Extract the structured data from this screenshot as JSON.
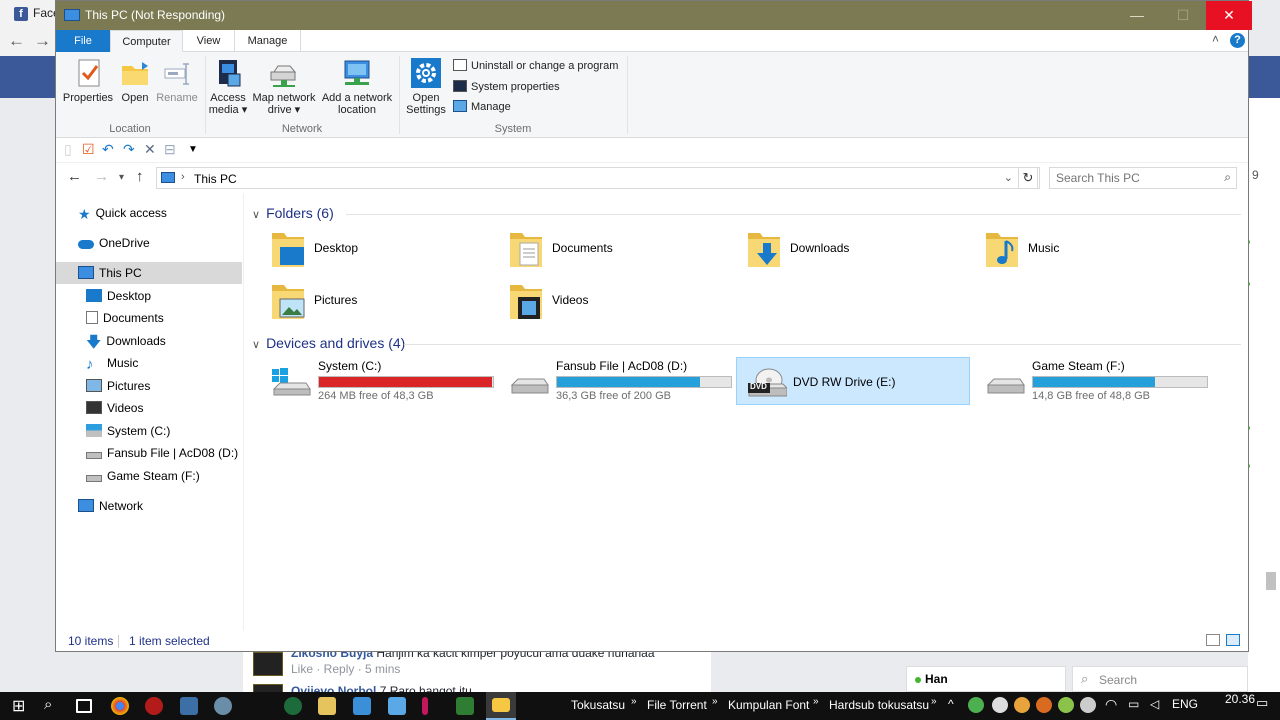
{
  "background": {
    "browser_tab": "Face",
    "comments": [
      {
        "author": "Zikosno Buyja",
        "text": "Hahjim ka kacit kimper poyucui ama duake nuhanaa"
      },
      {
        "actions": "Like · Reply · 5 mins"
      },
      {
        "author": "Ovijevo Norbol",
        "text": "7 Raro hangot itu"
      }
    ],
    "chat": {
      "name": "Han"
    },
    "search": {
      "placeholder": "Search"
    },
    "edge_digit": "9"
  },
  "window": {
    "title": "This PC (Not Responding)",
    "controls": {
      "minimize": "—",
      "maximize": "☐",
      "close": "✕"
    }
  },
  "ribbon": {
    "tabs": [
      "File",
      "Computer",
      "View",
      "Manage"
    ],
    "location": {
      "group": "Location",
      "properties": "Properties",
      "open": "Open",
      "rename": "Rename"
    },
    "network": {
      "group": "Network",
      "access_media_1": "Access",
      "access_media_2": "media ▾",
      "map_drive_1": "Map network",
      "map_drive_2": "drive ▾",
      "add_location_1": "Add a network",
      "add_location_2": "location"
    },
    "system": {
      "group": "System",
      "open_settings_1": "Open",
      "open_settings_2": "Settings",
      "uninstall": "Uninstall or change a program",
      "system_properties": "System properties",
      "manage": "Manage"
    }
  },
  "address": {
    "path": "This PC",
    "search_placeholder": "Search This PC"
  },
  "nav": {
    "quick_access": "Quick access",
    "onedrive": "OneDrive",
    "this_pc": "This PC",
    "items": [
      "Desktop",
      "Documents",
      "Downloads",
      "Music",
      "Pictures",
      "Videos",
      "System (C:)",
      "Fansub File | AcD08 (D:)",
      "Game Steam (F:)"
    ],
    "network": "Network"
  },
  "folders": {
    "header": "Folders (6)",
    "items": [
      "Desktop",
      "Documents",
      "Downloads",
      "Music",
      "Pictures",
      "Videos"
    ]
  },
  "drives": {
    "header": "Devices and drives (4)",
    "items": [
      {
        "name": "System (C:)",
        "free": "264 MB free of 48,3 GB",
        "used_fraction": 0.995
      },
      {
        "name": "Fansub File | AcD08 (D:)",
        "free": "36,3 GB free of 200 GB",
        "used_fraction": 0.82
      },
      {
        "name": "DVD RW Drive (E:)",
        "badge": "DVD"
      },
      {
        "name": "Game Steam (F:)",
        "free": "14,8 GB free of 48,8 GB",
        "used_fraction": 0.7
      }
    ]
  },
  "status": {
    "items": "10 items",
    "selected": "1 item selected"
  },
  "taskbar": {
    "toolbar_items": [
      "Tokusatsu",
      "File Torrent",
      "Kumpulan Font",
      "Hardsub tokusatsu"
    ],
    "language": "ENG",
    "time": "20.36",
    "chevron": "»"
  }
}
